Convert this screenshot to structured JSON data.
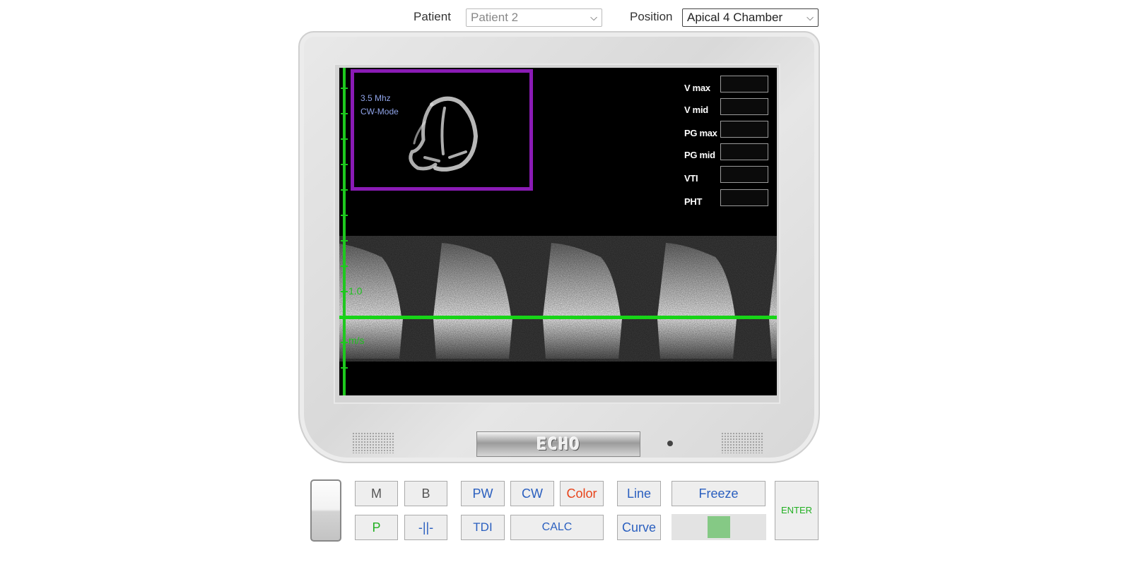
{
  "top": {
    "patient_label": "Patient",
    "patient_value": "Patient 2",
    "position_label": "Position",
    "position_value": "Apical 4 Chamber"
  },
  "screen": {
    "frequency": "3.5 Mhz",
    "mode": "CW-Mode",
    "axis_value": "1.0",
    "axis_unit": "m/s",
    "measurements": [
      {
        "label": "V max",
        "value": ""
      },
      {
        "label": "V mid",
        "value": ""
      },
      {
        "label": "PG max",
        "value": ""
      },
      {
        "label": "PG mid",
        "value": ""
      },
      {
        "label": "VTI",
        "value": ""
      },
      {
        "label": "PHT",
        "value": ""
      }
    ]
  },
  "monitor": {
    "brand": "ECHO"
  },
  "controls": {
    "m": "M",
    "b": "B",
    "pw": "PW",
    "cw": "CW",
    "color": "Color",
    "line": "Line",
    "freeze": "Freeze",
    "enter": "ENTER",
    "p": "P",
    "caliper": "-||-",
    "tdi": "TDI",
    "calc": "CALC",
    "curve": "Curve",
    "slider_level": 0.5
  },
  "colors": {
    "accent_blue": "#2a5fbf",
    "color_red": "#e8431a",
    "green": "#1ec81e",
    "inset_border": "#8a1bb5"
  }
}
